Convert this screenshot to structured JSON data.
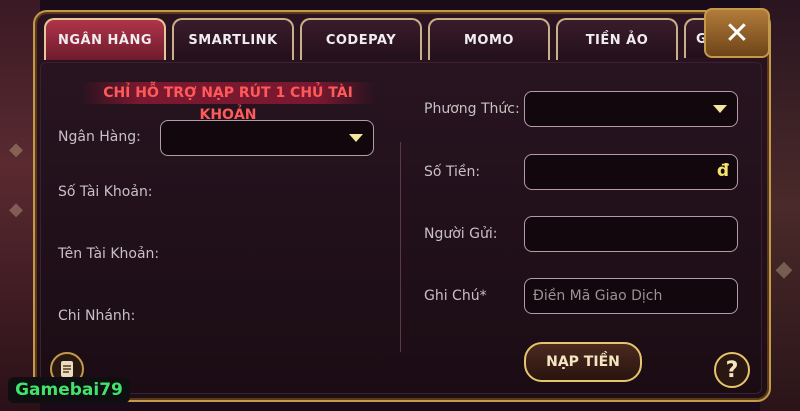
{
  "tabs": [
    "NGÂN HÀNG",
    "SMARTLINK",
    "CODEPAY",
    "MOMO",
    "TIỀN ẢO",
    "G"
  ],
  "active_tab": "NGÂN HÀNG",
  "close_label": "✕",
  "warning": "CHỈ HỖ TRỢ NẠP RÚT 1 CHỦ TÀI KHOẢN",
  "left": {
    "bank_label": "Ngân Hàng:",
    "account_number_label": "Số Tài Khoản:",
    "account_name_label": "Tên Tài Khoản:",
    "branch_label": "Chi Nhánh:"
  },
  "right": {
    "method_label": "Phương Thức:",
    "amount_label": "Số Tiền:",
    "currency_symbol": "đ",
    "sender_label": "Người Gửi:",
    "note_label": "Ghi Chú*",
    "note_placeholder": "Điền Mã Giao Dịch"
  },
  "submit_label": "NẠP TIỀN",
  "help_label": "?",
  "watermark": "Gamebai79",
  "colors": {
    "accent": "#c49a4a",
    "warning": "#ff5a5a",
    "active_tab": "#b0344a"
  },
  "icons": [
    "close-icon",
    "caret-down-icon",
    "history-icon",
    "help-icon"
  ]
}
